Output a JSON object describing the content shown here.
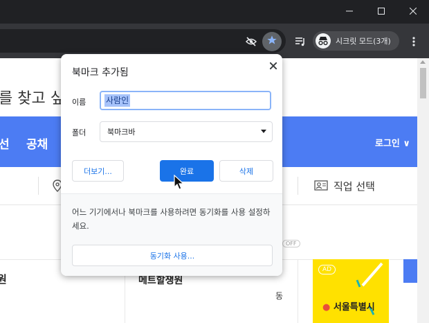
{
  "window": {
    "minimize_icon": "minimize-icon",
    "maximize_icon": "maximize-icon",
    "close_icon": "close-icon"
  },
  "toolbar": {
    "incognito_label": "시크릿 모드(3개)",
    "icons": [
      "eye-off-icon",
      "star-icon",
      "reading-list-icon",
      "incognito-icon",
      "more-vert-icon"
    ]
  },
  "page": {
    "headline": "를 찾고 싶",
    "nav": [
      "선",
      "공채"
    ],
    "login": "로그인 ∨",
    "job_filter": "직업 선택",
    "off_badge": "OFF",
    "ad_badge": "AD",
    "ad_city": "서울특별시",
    "card_title": "메트할쟁원",
    "card_fragment": "동"
  },
  "dialog": {
    "title": "북마크 추가됨",
    "name_label": "이름",
    "name_value": "사람인",
    "folder_label": "폴더",
    "folder_value": "북마크바",
    "more_button": "더보기...",
    "done_button": "완료",
    "delete_button": "삭제",
    "footer_text": "어느 기기에서나 북마크를 사용하려면 동기화를 사용 설정하세요.",
    "sync_button": "동기화 사용..."
  },
  "colors": {
    "accent": "#1a73e8",
    "nav_blue": "#4c7cf3",
    "chrome_dark": "#202124",
    "ad_yellow": "#ffe100"
  }
}
